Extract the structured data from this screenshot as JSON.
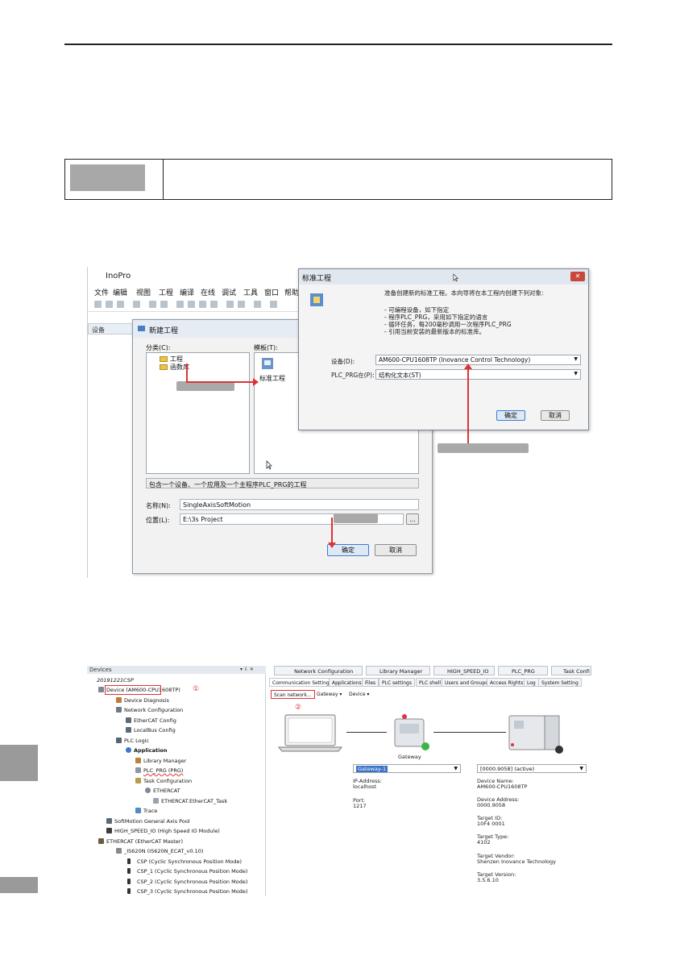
{
  "shot1": {
    "app_title": "InoPro",
    "menu": [
      "文件",
      "编辑",
      "视图",
      "工程",
      "编译",
      "在线",
      "调试",
      "工具",
      "窗口",
      "帮助"
    ],
    "devices_pane": "设备",
    "new_project": {
      "title": "新建工程",
      "categories_label": "分类(C):",
      "templates_label": "模板(T):",
      "tree": [
        "工程",
        "函数库"
      ],
      "template_item": "标准工程",
      "description": "包含一个设备、一个应用及一个主程序PLC_PRG的工程",
      "name_label": "名称(N):",
      "name_value": "SingleAxisSoftMotion",
      "location_label": "位置(L):",
      "location_value": "E:\\3s Project",
      "browse_label": "...",
      "ok_label": "确定",
      "cancel_label": "取消"
    },
    "standard_project": {
      "title": "标准工程",
      "intro": "准备创建新的标准工程。本向导将在本工程内创建下列对象:",
      "bullets": "- 可编程设备，如下指定\n- 程序PLC_PRG，采用如下指定的语言\n- 循环任务，每200毫秒调用一次程序PLC_PRG\n- 引用当前安装的最新版本的标准库。",
      "device_label": "设备(D):",
      "device_value": "AM600-CPU1608TP (Inovance Control Technology)",
      "plcprg_label": "PLC_PRG在(P):",
      "plcprg_value": "结构化文本(ST)",
      "ok_label": "确定",
      "cancel_label": "取消"
    }
  },
  "shot2": {
    "devices_header": "Devices",
    "tree": [
      "20191221CSP",
      "Device (AM600-CPU1608TP)",
      "Device Diagnosis",
      "Network Configuration",
      "EtherCAT Config",
      "LocalBus Config",
      "PLC Logic",
      "Application",
      "Library Manager",
      "PLC_PRG (PRG)",
      "Task Configuration",
      "ETHERCAT",
      "ETHERCAT.EtherCAT_Task",
      "Trace",
      "SoftMotion General Axis Pool",
      "HIGH_SPEED_IO (High Speed IO Module)",
      "ETHERCAT (EtherCAT Master)",
      "_IS620N (IS620N_ECAT_v0.10)",
      "CSP (Cyclic Synchronous Position Mode)",
      "CSP_1 (Cyclic Synchronous Position Mode)",
      "CSP_2 (Cyclic Synchronous Position Mode)",
      "CSP_3 (Cyclic Synchronous Position Mode)"
    ],
    "callout_1": "①",
    "callout_2": "②",
    "doc_tabs": [
      "Network Configuration",
      "Library Manager",
      "HIGH_SPEED_IO",
      "PLC_PRG",
      "Task Confi"
    ],
    "settings_tabs": [
      "Communication Settings",
      "Applications",
      "Files",
      "PLC settings",
      "PLC shell",
      "Users and Groups",
      "Access Rights",
      "Log",
      "System Setting"
    ],
    "scan_network": "Scan network...",
    "gateway_menu": "Gateway ▾",
    "device_menu": "Device ▾",
    "gateway_label": "Gateway",
    "gateway_select": "Gateway-1",
    "ip_label": "IP-Address:",
    "ip_value": "localhost",
    "port_label": "Port:",
    "port_value": "1217",
    "device_select": "[0000.9058] (active)",
    "device_name_label": "Device Name:",
    "device_name_value": "AM600-CPU1608TP",
    "device_addr_label": "Device Address:",
    "device_addr_value": "0000.9058",
    "target_id_label": "Target ID:",
    "target_id_value": "10F4 0001",
    "target_type_label": "Target Type:",
    "target_type_value": "4102",
    "target_vendor_label": "Target Vendor:",
    "target_vendor_value": "Shenzen Inovance Technology",
    "target_version_label": "Target Version:",
    "target_version_value": "3.5.6.10"
  }
}
